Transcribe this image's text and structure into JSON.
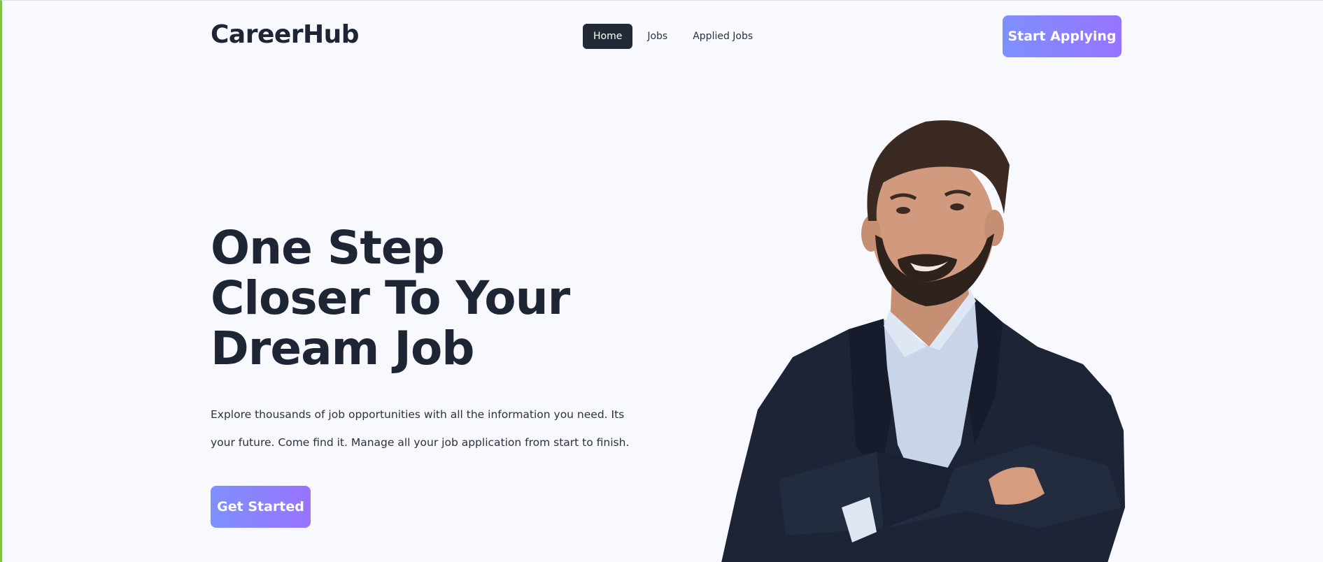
{
  "header": {
    "brand": "CareerHub",
    "nav": [
      {
        "label": "Home",
        "active": true
      },
      {
        "label": "Jobs",
        "active": false
      },
      {
        "label": "Applied Jobs",
        "active": false
      }
    ],
    "cta_label": "Start Applying"
  },
  "hero": {
    "title_lines": [
      "One Step",
      "Closer To Your",
      "Dream Job"
    ],
    "description": "Explore thousands of job opportunities with all the information you need. Its your future. Come find it. Manage all your job application from start to finish.",
    "cta_label": "Get Started"
  },
  "colors": {
    "background": "#f8f9fe",
    "text_dark": "#1e2635",
    "gradient_start": "#7e90fe",
    "gradient_end": "#9873ff",
    "nav_active": "#232a37"
  }
}
